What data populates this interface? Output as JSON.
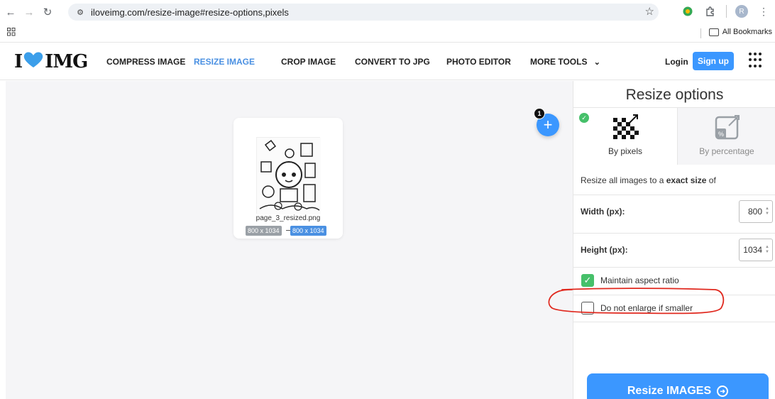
{
  "browser": {
    "url": "iloveimg.com/resize-image#resize-options,pixels",
    "profile_initial": "R",
    "all_bookmarks": "All Bookmarks"
  },
  "header": {
    "logo_left": "I",
    "logo_right": "IMG",
    "nav": [
      "COMPRESS IMAGE",
      "RESIZE IMAGE",
      "CROP IMAGE",
      "CONVERT TO JPG",
      "PHOTO EDITOR",
      "MORE TOOLS"
    ],
    "active_nav": "RESIZE IMAGE",
    "login": "Login",
    "signup": "Sign up"
  },
  "workspace": {
    "file_count": "1",
    "file": {
      "name": "page_3_resized.png",
      "original_size": "800 x 1034",
      "new_size": "800 x 1034"
    }
  },
  "panel": {
    "title": "Resize options",
    "tabs": [
      {
        "label": "By pixels",
        "selected": true
      },
      {
        "label": "By percentage",
        "selected": false
      }
    ],
    "description_prefix": "Resize all images to a ",
    "description_bold": "exact size",
    "description_suffix": " of",
    "width_label": "Width (px):",
    "width_value": "800",
    "height_label": "Height (px):",
    "height_value": "1034",
    "maintain_aspect": {
      "label": "Maintain aspect ratio",
      "checked": true
    },
    "no_enlarge": {
      "label": "Do not enlarge if smaller",
      "checked": false
    },
    "submit": "Resize IMAGES"
  },
  "colors": {
    "accent": "#3b97ff",
    "check": "#46c06a",
    "annotation": "#e0281e"
  }
}
